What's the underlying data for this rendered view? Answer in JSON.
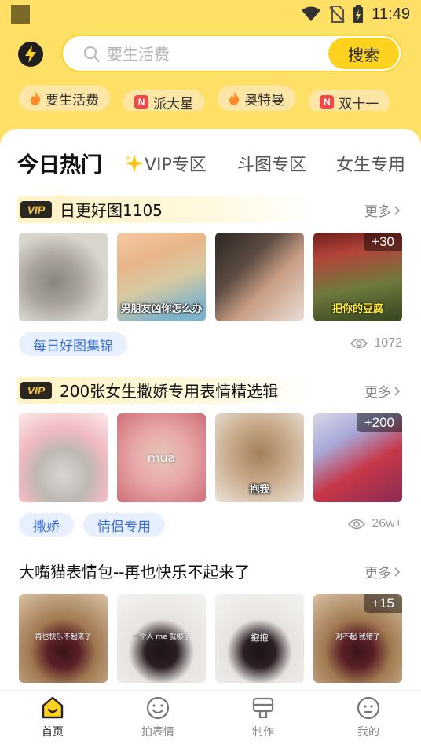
{
  "status_bar": {
    "time": "11:49"
  },
  "search": {
    "placeholder": "要生活费",
    "button_label": "搜索"
  },
  "hot_chips": [
    {
      "label": "要生活费",
      "icon": "flame-icon"
    },
    {
      "label": "派大星",
      "icon": "n-badge-icon",
      "badge_text": "N"
    },
    {
      "label": "奥特曼",
      "icon": "flame-icon"
    },
    {
      "label": "双十一",
      "icon": "n-badge-icon",
      "badge_text": "N"
    }
  ],
  "tabs": [
    {
      "label": "今日热门",
      "active": true
    },
    {
      "label": "VIP专区",
      "icon": "sparkle-icon"
    },
    {
      "label": "斗图专区"
    },
    {
      "label": "女生专用"
    }
  ],
  "sections": [
    {
      "vip": true,
      "vip_label": "VIP",
      "title": "日更好图1105",
      "more_label": "更多",
      "thumbs": [
        {
          "caption": ""
        },
        {
          "caption": "男朋友凶你怎么办"
        },
        {
          "caption": ""
        },
        {
          "caption": "把你的豆腐",
          "plus": "+30"
        }
      ],
      "tags": [
        "每日好图集锦"
      ],
      "views": "1072"
    },
    {
      "vip": true,
      "vip_label": "VIP",
      "title": "200张女生撒娇专用表情精选辑",
      "more_label": "更多",
      "thumbs": [
        {
          "caption": ""
        },
        {
          "caption": "mua"
        },
        {
          "caption": "抱我"
        },
        {
          "caption": "",
          "plus": "+200"
        }
      ],
      "tags": [
        "撒娇",
        "情侣专用"
      ],
      "views": "26w+"
    },
    {
      "vip": false,
      "title": "大嘴猫表情包--再也快乐不起来了",
      "more_label": "更多",
      "thumbs": [
        {
          "caption": "再也快乐不起来了"
        },
        {
          "caption": "一个人 me 就够了"
        },
        {
          "caption": "抱抱"
        },
        {
          "caption": "对不起 我错了",
          "plus": "+15"
        }
      ]
    }
  ],
  "bottom_nav": [
    {
      "label": "首页",
      "icon": "home-icon",
      "active": true
    },
    {
      "label": "拍表情",
      "icon": "smile-icon"
    },
    {
      "label": "制作",
      "icon": "make-icon"
    },
    {
      "label": "我的",
      "icon": "profile-icon"
    }
  ],
  "colors": {
    "brand_yellow": "#ffd21f",
    "header_bg": "#ffe066",
    "tag_blue": "#3a6fd8"
  }
}
